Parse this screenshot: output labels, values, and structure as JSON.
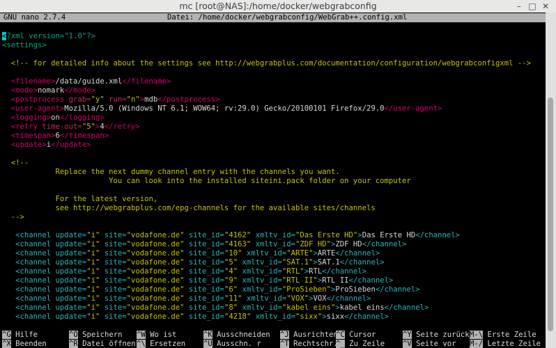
{
  "window": {
    "title": "mc [root@NAS]:/home/docker/webgrabconfig"
  },
  "nano": {
    "version": "GNU nano 2.7.4",
    "file": "Datei: /home/docker/webgrabconfig/WebGrab++.config.xml",
    "lines": [
      [
        [
          "cursor",
          "<"
        ],
        [
          "bracket",
          "?xml version=\"1.0\"?>"
        ]
      ],
      [
        [
          "bracket",
          "<settings>"
        ]
      ],
      [],
      [
        [
          "cmt",
          "  <!-- for detailed info about the settings see http://webgrabplus.com/documentation/configuration/webgrabconfigxml -->"
        ]
      ],
      [],
      [
        [
          "tag",
          "  <filename>"
        ],
        [
          "txt",
          "/data/guide.xml"
        ],
        [
          "tag",
          "</filename>"
        ]
      ],
      [
        [
          "tag",
          "  <mode>"
        ],
        [
          "txt",
          "nomark"
        ],
        [
          "tag",
          "</mode>"
        ]
      ],
      [
        [
          "tag",
          "  <postprocess "
        ],
        [
          "attr",
          "grab="
        ],
        [
          "str",
          "\"y\""
        ],
        [
          "attr",
          " run="
        ],
        [
          "str",
          "\"n\""
        ],
        [
          "tag",
          ">"
        ],
        [
          "txt",
          "mdb"
        ],
        [
          "tag",
          "</postprocess>"
        ]
      ],
      [
        [
          "tag",
          "  <user-agent>"
        ],
        [
          "txt",
          "Mozilla/5.0 (Windows NT 6.1; WOW64; rv:29.0) Gecko/20100101 Firefox/29.0"
        ],
        [
          "tag",
          "</user-agent>"
        ]
      ],
      [
        [
          "tag",
          "  <logging>"
        ],
        [
          "txt",
          "on"
        ],
        [
          "tag",
          "</logging>"
        ]
      ],
      [
        [
          "tag",
          "  <retry "
        ],
        [
          "attr",
          "time-out="
        ],
        [
          "str",
          "\"5\""
        ],
        [
          "tag",
          ">"
        ],
        [
          "txt",
          "4"
        ],
        [
          "tag",
          "</retry>"
        ]
      ],
      [
        [
          "tag",
          "  <timespan>"
        ],
        [
          "txt",
          "6"
        ],
        [
          "tag",
          "</timespan>"
        ]
      ],
      [
        [
          "tag",
          "  <update>"
        ],
        [
          "txt",
          "i"
        ],
        [
          "tag",
          "</update>"
        ]
      ],
      [],
      [
        [
          "cmt",
          "  <!--"
        ]
      ],
      [
        [
          "cmt",
          "            Replace the next dummy channel entry with the channels you want."
        ]
      ],
      [
        [
          "cmt",
          "                        You can look into the installed siteini.pack folder on your computer"
        ]
      ],
      [],
      [
        [
          "cmt",
          "            For the latest version,"
        ]
      ],
      [
        [
          "cmt",
          "            see http://webgrabplus.com/epg-channels for the available sites/channels"
        ]
      ],
      [
        [
          "cmt",
          "  -->"
        ]
      ],
      [],
      [
        [
          "chtag",
          "   <channel update="
        ],
        [
          "str",
          "\"i\""
        ],
        [
          "chtag",
          " site="
        ],
        [
          "str",
          "\"vodafone.de\""
        ],
        [
          "chtag",
          " site_id="
        ],
        [
          "str",
          "\"4162\""
        ],
        [
          "chtag",
          " xmltv_id="
        ],
        [
          "str",
          "\"Das Erste HD\""
        ],
        [
          "chtag",
          ">"
        ],
        [
          "txt",
          "Das Erste HD"
        ],
        [
          "chtag",
          "</channel>"
        ]
      ],
      [
        [
          "chtag",
          "   <channel update="
        ],
        [
          "str",
          "\"i\""
        ],
        [
          "chtag",
          " site="
        ],
        [
          "str",
          "\"vodafone.de\""
        ],
        [
          "chtag",
          " site_id="
        ],
        [
          "str",
          "\"4163\""
        ],
        [
          "chtag",
          " xmltv_id="
        ],
        [
          "str",
          "\"ZDF HD\""
        ],
        [
          "chtag",
          ">"
        ],
        [
          "txt",
          "ZDF HD"
        ],
        [
          "chtag",
          "</channel>"
        ]
      ],
      [
        [
          "chtag",
          "   <channel update="
        ],
        [
          "str",
          "\"i\""
        ],
        [
          "chtag",
          " site="
        ],
        [
          "str",
          "\"vodafone.de\""
        ],
        [
          "chtag",
          " site_id="
        ],
        [
          "str",
          "\"10\""
        ],
        [
          "chtag",
          " xmltv_id="
        ],
        [
          "str",
          "\"ARTE\""
        ],
        [
          "chtag",
          ">"
        ],
        [
          "txt",
          "ARTE"
        ],
        [
          "chtag",
          "</channel>"
        ]
      ],
      [
        [
          "chtag",
          "   <channel update="
        ],
        [
          "str",
          "\"i\""
        ],
        [
          "chtag",
          " site="
        ],
        [
          "str",
          "\"vodafone.de\""
        ],
        [
          "chtag",
          " site_id="
        ],
        [
          "str",
          "\"5\""
        ],
        [
          "chtag",
          " xmltv_id="
        ],
        [
          "str",
          "\"SAT.1\""
        ],
        [
          "chtag",
          ">"
        ],
        [
          "txt",
          "SAT.1"
        ],
        [
          "chtag",
          "</channel>"
        ]
      ],
      [
        [
          "chtag",
          "   <channel update="
        ],
        [
          "str",
          "\"i\""
        ],
        [
          "chtag",
          " site="
        ],
        [
          "str",
          "\"vodafone.de\""
        ],
        [
          "chtag",
          " site_id="
        ],
        [
          "str",
          "\"4\""
        ],
        [
          "chtag",
          " xmltv_id="
        ],
        [
          "str",
          "\"RTL\""
        ],
        [
          "chtag",
          ">"
        ],
        [
          "txt",
          "RTL"
        ],
        [
          "chtag",
          "</channel>"
        ]
      ],
      [
        [
          "chtag",
          "   <channel update="
        ],
        [
          "str",
          "\"i\""
        ],
        [
          "chtag",
          " site="
        ],
        [
          "str",
          "\"vodafone.de\""
        ],
        [
          "chtag",
          " site_id="
        ],
        [
          "str",
          "\"9\""
        ],
        [
          "chtag",
          " xmltv_id="
        ],
        [
          "str",
          "\"RTL II\""
        ],
        [
          "chtag",
          ">"
        ],
        [
          "txt",
          "RTL II"
        ],
        [
          "chtag",
          "</channel>"
        ]
      ],
      [
        [
          "chtag",
          "   <channel update="
        ],
        [
          "str",
          "\"i\""
        ],
        [
          "chtag",
          " site="
        ],
        [
          "str",
          "\"vodafone.de\""
        ],
        [
          "chtag",
          " site_id="
        ],
        [
          "str",
          "\"6\""
        ],
        [
          "chtag",
          " xmltv_id="
        ],
        [
          "str",
          "\"ProSieben\""
        ],
        [
          "chtag",
          ">"
        ],
        [
          "txt",
          "ProSieben"
        ],
        [
          "chtag",
          "</channel>"
        ]
      ],
      [
        [
          "chtag",
          "   <channel update="
        ],
        [
          "str",
          "\"i\""
        ],
        [
          "chtag",
          " site="
        ],
        [
          "str",
          "\"vodafone.de\""
        ],
        [
          "chtag",
          " site_id="
        ],
        [
          "str",
          "\"11\""
        ],
        [
          "chtag",
          " xmltv_id="
        ],
        [
          "str",
          "\"VOX\""
        ],
        [
          "chtag",
          ">"
        ],
        [
          "txt",
          "VOX"
        ],
        [
          "chtag",
          "</channel>"
        ]
      ],
      [
        [
          "chtag",
          "   <channel update="
        ],
        [
          "str",
          "\"i\""
        ],
        [
          "chtag",
          " site="
        ],
        [
          "str",
          "\"vodafone.de\""
        ],
        [
          "chtag",
          " site_id="
        ],
        [
          "str",
          "\"8\""
        ],
        [
          "chtag",
          " xmltv_id="
        ],
        [
          "str",
          "\"kabel eins\""
        ],
        [
          "chtag",
          ">"
        ],
        [
          "txt",
          "kabel eins"
        ],
        [
          "chtag",
          "</channel>"
        ]
      ],
      [
        [
          "chtag",
          "   <channel update="
        ],
        [
          "str",
          "\"i\""
        ],
        [
          "chtag",
          " site="
        ],
        [
          "str",
          "\"vodafone.de\""
        ],
        [
          "chtag",
          " site_id="
        ],
        [
          "str",
          "\"4218\""
        ],
        [
          "chtag",
          " xmltv_id="
        ],
        [
          "str",
          "\"sixx\""
        ],
        [
          "chtag",
          ">"
        ],
        [
          "txt",
          "sixx"
        ],
        [
          "chtag",
          "</channel>"
        ]
      ]
    ],
    "shortcuts": [
      {
        "key": "^G",
        "label": "Hilfe"
      },
      {
        "key": "^O",
        "label": "Speichern"
      },
      {
        "key": "^W",
        "label": "Wo ist"
      },
      {
        "key": "^K",
        "label": "Ausschneiden"
      },
      {
        "key": "^J",
        "label": "Ausrichten"
      },
      {
        "key": "^C",
        "label": "Cursor"
      },
      {
        "key": "^Y",
        "label": "Seite zurück"
      },
      {
        "key": "M-\\",
        "label": "Erste Zeile"
      },
      {
        "key": "^X",
        "label": "Beenden"
      },
      {
        "key": "^R",
        "label": "Datei öffnen"
      },
      {
        "key": "^\\",
        "label": "Ersetzen"
      },
      {
        "key": "^U",
        "label": "Ausschn. r"
      },
      {
        "key": "^T",
        "label": "Rechtschr."
      },
      {
        "key": "^_",
        "label": "Zu Zeile"
      },
      {
        "key": "^V",
        "label": "Seite vor"
      },
      {
        "key": "M-/",
        "label": "Letzte Zeile"
      }
    ]
  },
  "colors": {
    "background": "#000000",
    "statusbar": "#b2b2b2",
    "tag": "#d5006e",
    "channel": "#2bb5b5",
    "string": "#c4c400"
  }
}
